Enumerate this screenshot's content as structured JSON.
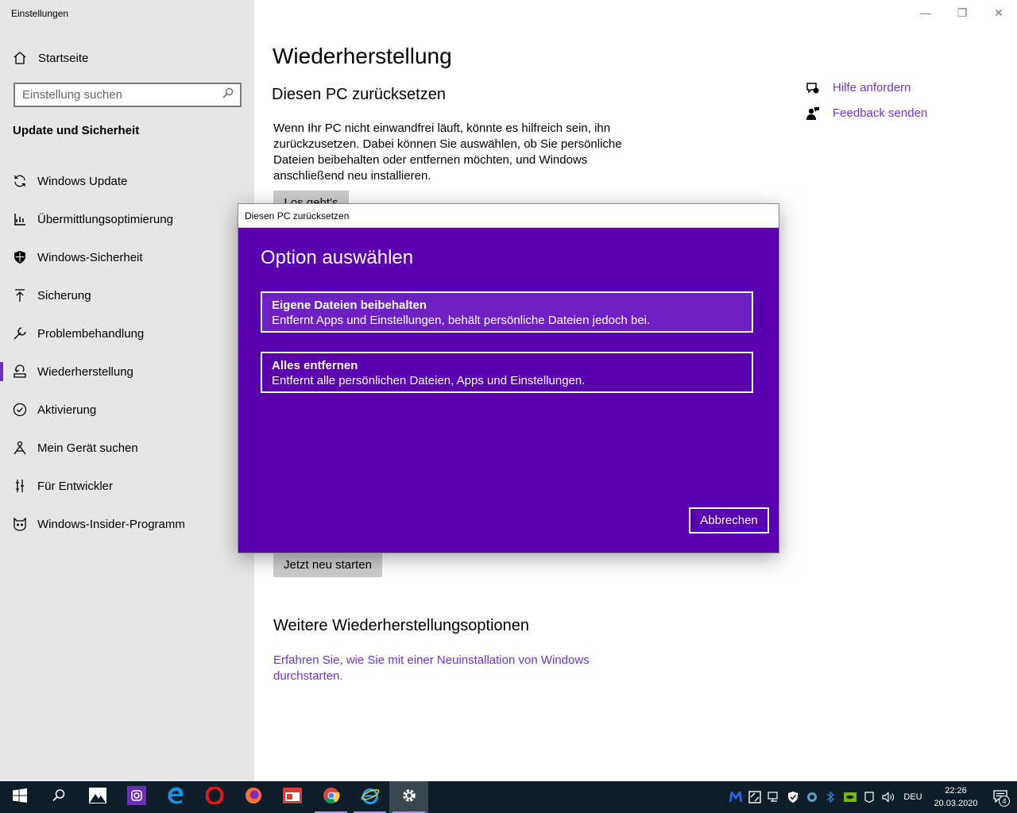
{
  "window": {
    "title": "Einstellungen",
    "controls": {
      "minimize": "—",
      "restore": "❐",
      "close": "✕"
    }
  },
  "sidebar": {
    "home_label": "Startseite",
    "search_placeholder": "Einstellung suchen",
    "section_title": "Update und Sicherheit",
    "items": [
      {
        "label": "Windows Update",
        "icon": "sync-icon"
      },
      {
        "label": "Übermittlungsoptimierung",
        "icon": "delivery-optimization-icon"
      },
      {
        "label": "Windows-Sicherheit",
        "icon": "shield-icon"
      },
      {
        "label": "Sicherung",
        "icon": "backup-arrow-icon"
      },
      {
        "label": "Problembehandlung",
        "icon": "wrench-icon"
      },
      {
        "label": "Wiederherstellung",
        "icon": "recovery-icon",
        "active": true
      },
      {
        "label": "Aktivierung",
        "icon": "check-circle-icon"
      },
      {
        "label": "Mein Gerät suchen",
        "icon": "find-device-icon"
      },
      {
        "label": "Für Entwickler",
        "icon": "developer-icon"
      },
      {
        "label": "Windows-Insider-Programm",
        "icon": "insider-cat-icon"
      }
    ]
  },
  "main": {
    "title": "Wiederherstellung",
    "reset_heading": "Diesen PC zurücksetzen",
    "reset_text": "Wenn Ihr PC nicht einwandfrei läuft, könnte es hilfreich sein, ihn zurückzusetzen. Dabei können Sie auswählen, ob Sie persönliche Dateien beibehalten oder entfernen möchten, und Windows anschließend neu installieren.",
    "reset_button": "Los geht's",
    "restart_button": "Jetzt neu starten",
    "more_heading": "Weitere Wiederherstellungsoptionen",
    "more_link": "Erfahren Sie, wie Sie mit einer Neuinstallation von Windows durchstarten."
  },
  "help": {
    "get_help": "Hilfe anfordern",
    "feedback": "Feedback senden"
  },
  "dialog": {
    "title": "Diesen PC zurücksetzen",
    "heading": "Option auswählen",
    "options": [
      {
        "title": "Eigene Dateien beibehalten",
        "desc": "Entfernt Apps und Einstellungen, behält persönliche Dateien jedoch bei."
      },
      {
        "title": "Alles entfernen",
        "desc": "Entfernt alle persönlichen Dateien, Apps und Einstellungen."
      }
    ],
    "cancel": "Abbrechen"
  },
  "taskbar": {
    "apps": [
      "start-icon",
      "search-icon",
      "photos-icon",
      "instagram-icon",
      "edge-icon",
      "opera-icon",
      "firefox-icon",
      "news-icon",
      "chrome-icon",
      "internet-explorer-icon",
      "settings-gear-icon"
    ],
    "language": "DEU",
    "time": "22:26",
    "date": "20.03.2020",
    "notification_count": "4"
  },
  "colors": {
    "accent": "#6b2fb3",
    "dialog_bg": "#5a00b0",
    "link": "#7034c7",
    "taskbar": "#0e1e29"
  }
}
